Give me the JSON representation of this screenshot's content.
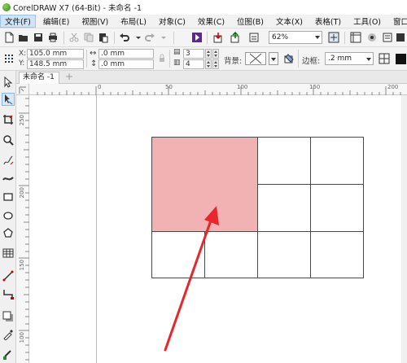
{
  "window": {
    "title": "CorelDRAW X7 (64-Bit) - 未命名 -1"
  },
  "menu": [
    {
      "label": "文件(F)",
      "active": true
    },
    {
      "label": "编辑(E)"
    },
    {
      "label": "视图(V)"
    },
    {
      "label": "布局(L)"
    },
    {
      "label": "对象(C)"
    },
    {
      "label": "效果(C)"
    },
    {
      "label": "位图(B)"
    },
    {
      "label": "文本(X)"
    },
    {
      "label": "表格(T)"
    },
    {
      "label": "工具(O)"
    },
    {
      "label": "窗口(W)"
    },
    {
      "label": "帮"
    }
  ],
  "toolbar": {
    "zoom": "62%"
  },
  "propbar": {
    "x_label": "X:",
    "x_value": "105.0 mm",
    "y_label": "Y:",
    "y_value": "148.5 mm",
    "w_value": ".0 mm",
    "h_value": ".0 mm",
    "rows": "3",
    "cols": "4",
    "background_label": "背景:",
    "border_label": "边框:",
    "border_value": ".2 mm"
  },
  "document": {
    "tab_label": "未命名 -1",
    "add_tab": "+"
  },
  "ruler": {
    "h_labels": [
      "0",
      "50",
      "100",
      "150",
      "200"
    ],
    "v_labels": [
      "250",
      "200",
      "150",
      "100"
    ]
  },
  "table": {
    "merged_fill": "#f2b2b4",
    "border_color": "#4a4a4a"
  },
  "annotation": {
    "arrow_color": "#e8262b"
  }
}
